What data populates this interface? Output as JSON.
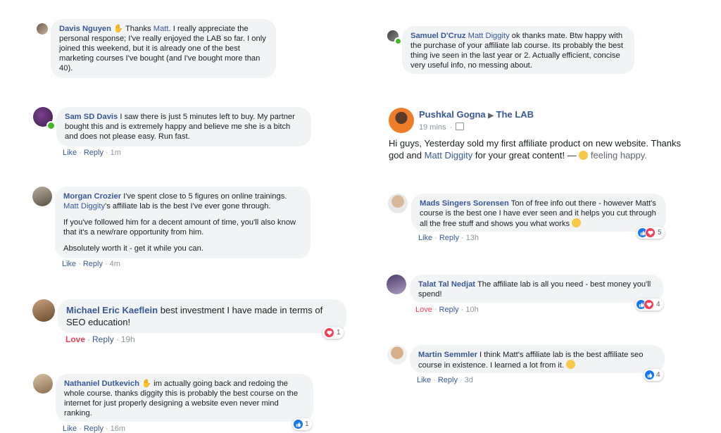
{
  "comments": {
    "davis": {
      "name": "Davis Nguyen",
      "mention": "Matt",
      "text": ". I really appreciate the personal response; I've really enjoyed the LAB so far. I only joined this weekend, but it is already one of the best marketing courses I've bought (and I've bought more than 40).",
      "pre": "Thanks "
    },
    "sam": {
      "name": "Sam SD Davis",
      "text": "I saw there is just 5 minutes left to buy. My partner bought this and is extremely happy and believe me she is a bitch and does not please easy. Run fast.",
      "like": "Like",
      "reply": "Reply",
      "time": "1m"
    },
    "morgan": {
      "name": "Morgan Crozier",
      "text1": "I've spent close to 5 figures on online trainings.",
      "mention": "Matt Diggity",
      "text1b": "'s affiliate lab is the best I've ever gone through.",
      "text2": "If you've followed him for a decent amount of time, you'll also know that it's a new/rare opportunity from him.",
      "text3": "Absolutely worth it - get it while you can.",
      "like": "Like",
      "reply": "Reply",
      "time": "4m"
    },
    "michael": {
      "name": "Michael Eric Kaeflein",
      "text": "best investment I have made in terms of SEO education!",
      "love": "Love",
      "reply": "Reply",
      "time": "19h",
      "reactions": "1"
    },
    "nathaniel": {
      "name": "Nathaniel Dutkevich",
      "text": "im actually going back and redoing the whole course. thanks diggity this is probably the best course on the internet for just properly designing a website even never mind ranking.",
      "like": "Like",
      "reply": "Reply",
      "time": "16m",
      "reactions": "1"
    },
    "samuel": {
      "name": "Samuel D'Cruz",
      "mention": "Matt Diggity",
      "text": "ok thanks mate. Btw happy with the purchase of your affiliate lab course. Its probably the best thing ive seen in the last year or 2. Actually efficient, concise very useful info, no messing about."
    },
    "mads": {
      "name": "Mads Singers Sorensen",
      "text": "Ton of free info out there - however Matt's course is the best one I have ever seen and it helps you cut through all the free stuff and shows you what works",
      "like": "Like",
      "reply": "Reply",
      "time": "13h",
      "reactions": "5"
    },
    "talat": {
      "name": "Talat Tal Nedjat",
      "text": "The affiliate lab is all you need - best money you'll spend!",
      "love": "Love",
      "reply": "Reply",
      "time": "10h",
      "reactions": "4"
    },
    "martin": {
      "name": "Martin Semmler",
      "text": "I think Matt's affiliate lab is the best affiliate seo course in existence. I learned a lot from it.",
      "like": "Like",
      "reply": "Reply",
      "time": "3d",
      "reactions": "4"
    }
  },
  "post": {
    "author": "Pushkal Gogna",
    "group": "The LAB",
    "time": "19 mins",
    "text1": "Hi guys, Yesterday sold my first affiliate product on new website. Thanks god and",
    "mention": "Matt Diggity",
    "text2": "for your great content! — ",
    "feeling": "feeling happy."
  },
  "colors": {
    "link": "#385898",
    "bubble": "#f2f3f5",
    "love": "#f33e58",
    "like": "#1877f2",
    "online": "#42b72a"
  }
}
